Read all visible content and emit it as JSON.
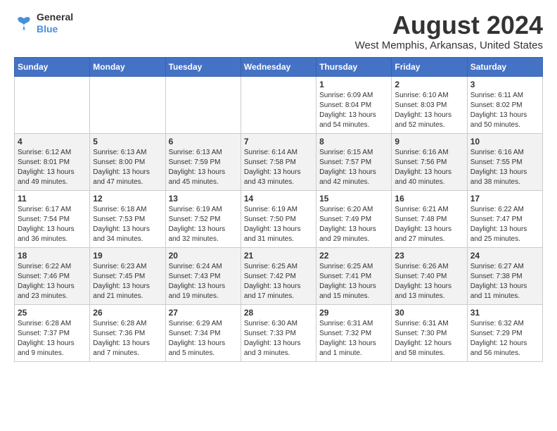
{
  "logo": {
    "line1": "General",
    "line2": "Blue"
  },
  "title": "August 2024",
  "subtitle": "West Memphis, Arkansas, United States",
  "days_of_week": [
    "Sunday",
    "Monday",
    "Tuesday",
    "Wednesday",
    "Thursday",
    "Friday",
    "Saturday"
  ],
  "weeks": [
    [
      {
        "day": "",
        "info": ""
      },
      {
        "day": "",
        "info": ""
      },
      {
        "day": "",
        "info": ""
      },
      {
        "day": "",
        "info": ""
      },
      {
        "day": "1",
        "info": "Sunrise: 6:09 AM\nSunset: 8:04 PM\nDaylight: 13 hours\nand 54 minutes."
      },
      {
        "day": "2",
        "info": "Sunrise: 6:10 AM\nSunset: 8:03 PM\nDaylight: 13 hours\nand 52 minutes."
      },
      {
        "day": "3",
        "info": "Sunrise: 6:11 AM\nSunset: 8:02 PM\nDaylight: 13 hours\nand 50 minutes."
      }
    ],
    [
      {
        "day": "4",
        "info": "Sunrise: 6:12 AM\nSunset: 8:01 PM\nDaylight: 13 hours\nand 49 minutes."
      },
      {
        "day": "5",
        "info": "Sunrise: 6:13 AM\nSunset: 8:00 PM\nDaylight: 13 hours\nand 47 minutes."
      },
      {
        "day": "6",
        "info": "Sunrise: 6:13 AM\nSunset: 7:59 PM\nDaylight: 13 hours\nand 45 minutes."
      },
      {
        "day": "7",
        "info": "Sunrise: 6:14 AM\nSunset: 7:58 PM\nDaylight: 13 hours\nand 43 minutes."
      },
      {
        "day": "8",
        "info": "Sunrise: 6:15 AM\nSunset: 7:57 PM\nDaylight: 13 hours\nand 42 minutes."
      },
      {
        "day": "9",
        "info": "Sunrise: 6:16 AM\nSunset: 7:56 PM\nDaylight: 13 hours\nand 40 minutes."
      },
      {
        "day": "10",
        "info": "Sunrise: 6:16 AM\nSunset: 7:55 PM\nDaylight: 13 hours\nand 38 minutes."
      }
    ],
    [
      {
        "day": "11",
        "info": "Sunrise: 6:17 AM\nSunset: 7:54 PM\nDaylight: 13 hours\nand 36 minutes."
      },
      {
        "day": "12",
        "info": "Sunrise: 6:18 AM\nSunset: 7:53 PM\nDaylight: 13 hours\nand 34 minutes."
      },
      {
        "day": "13",
        "info": "Sunrise: 6:19 AM\nSunset: 7:52 PM\nDaylight: 13 hours\nand 32 minutes."
      },
      {
        "day": "14",
        "info": "Sunrise: 6:19 AM\nSunset: 7:50 PM\nDaylight: 13 hours\nand 31 minutes."
      },
      {
        "day": "15",
        "info": "Sunrise: 6:20 AM\nSunset: 7:49 PM\nDaylight: 13 hours\nand 29 minutes."
      },
      {
        "day": "16",
        "info": "Sunrise: 6:21 AM\nSunset: 7:48 PM\nDaylight: 13 hours\nand 27 minutes."
      },
      {
        "day": "17",
        "info": "Sunrise: 6:22 AM\nSunset: 7:47 PM\nDaylight: 13 hours\nand 25 minutes."
      }
    ],
    [
      {
        "day": "18",
        "info": "Sunrise: 6:22 AM\nSunset: 7:46 PM\nDaylight: 13 hours\nand 23 minutes."
      },
      {
        "day": "19",
        "info": "Sunrise: 6:23 AM\nSunset: 7:45 PM\nDaylight: 13 hours\nand 21 minutes."
      },
      {
        "day": "20",
        "info": "Sunrise: 6:24 AM\nSunset: 7:43 PM\nDaylight: 13 hours\nand 19 minutes."
      },
      {
        "day": "21",
        "info": "Sunrise: 6:25 AM\nSunset: 7:42 PM\nDaylight: 13 hours\nand 17 minutes."
      },
      {
        "day": "22",
        "info": "Sunrise: 6:25 AM\nSunset: 7:41 PM\nDaylight: 13 hours\nand 15 minutes."
      },
      {
        "day": "23",
        "info": "Sunrise: 6:26 AM\nSunset: 7:40 PM\nDaylight: 13 hours\nand 13 minutes."
      },
      {
        "day": "24",
        "info": "Sunrise: 6:27 AM\nSunset: 7:38 PM\nDaylight: 13 hours\nand 11 minutes."
      }
    ],
    [
      {
        "day": "25",
        "info": "Sunrise: 6:28 AM\nSunset: 7:37 PM\nDaylight: 13 hours\nand 9 minutes."
      },
      {
        "day": "26",
        "info": "Sunrise: 6:28 AM\nSunset: 7:36 PM\nDaylight: 13 hours\nand 7 minutes."
      },
      {
        "day": "27",
        "info": "Sunrise: 6:29 AM\nSunset: 7:34 PM\nDaylight: 13 hours\nand 5 minutes."
      },
      {
        "day": "28",
        "info": "Sunrise: 6:30 AM\nSunset: 7:33 PM\nDaylight: 13 hours\nand 3 minutes."
      },
      {
        "day": "29",
        "info": "Sunrise: 6:31 AM\nSunset: 7:32 PM\nDaylight: 13 hours\nand 1 minute."
      },
      {
        "day": "30",
        "info": "Sunrise: 6:31 AM\nSunset: 7:30 PM\nDaylight: 12 hours\nand 58 minutes."
      },
      {
        "day": "31",
        "info": "Sunrise: 6:32 AM\nSunset: 7:29 PM\nDaylight: 12 hours\nand 56 minutes."
      }
    ]
  ]
}
